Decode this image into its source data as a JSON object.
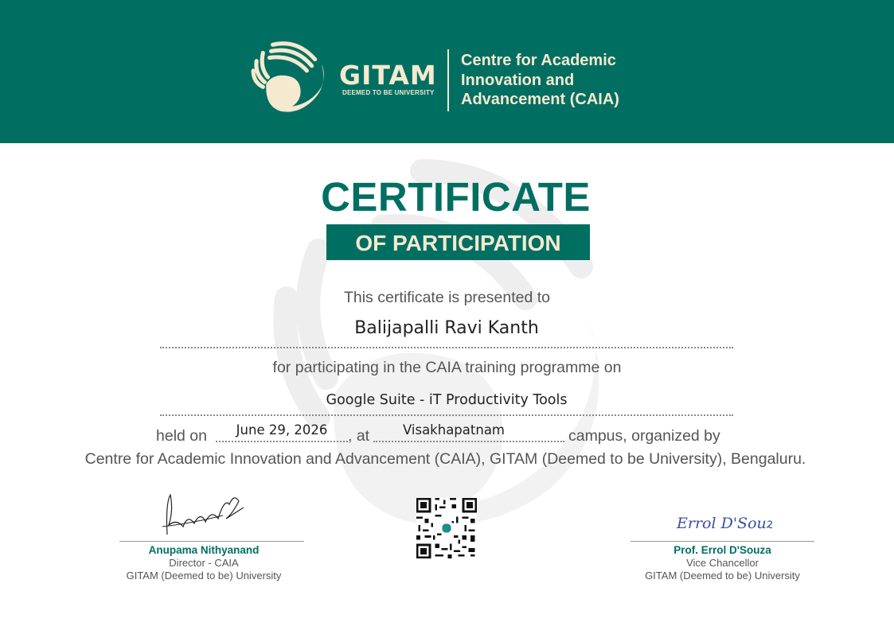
{
  "colors": {
    "brand": "#006f62",
    "cream": "#f5e9cf",
    "watermark": "#eeeeee"
  },
  "header": {
    "logo_text": "GITAM",
    "logo_tagline": "DEEMED TO BE UNIVERSITY",
    "centre_name_lines": [
      "Centre for Academic",
      "Innovation and",
      "Advancement (CAIA)"
    ]
  },
  "certificate": {
    "title": "CERTIFICATE",
    "subtitle": "OF PARTICIPATION",
    "presented_to": "This certificate is presented to",
    "recipient_name": "Balijapalli Ravi Kanth",
    "participating_text": "for participating in the CAIA training programme on",
    "programme_name": "Google Suite - iT Productivity Tools",
    "held_on_label": "held on",
    "date": "June 29, 2026",
    "at_label": ", at",
    "location": "Visakhapatnam",
    "campus_text": "campus, organized by",
    "organizer_text": "Centre for Academic Innovation and Advancement (CAIA), GITAM (Deemed to be University), Bengaluru."
  },
  "signatories": {
    "left": {
      "signature_text": "Anupama N",
      "name": "Anupama Nithyanand",
      "title": "Director - CAIA",
      "org": "GITAM (Deemed to be) University"
    },
    "right": {
      "signature_text": "Errol D'Souza",
      "name": "Prof. Errol D'Souza",
      "title": "Vice Chancellor",
      "org": "GITAM (Deemed to be) University"
    }
  },
  "qr_code": {
    "icon": "qr-code-icon"
  }
}
